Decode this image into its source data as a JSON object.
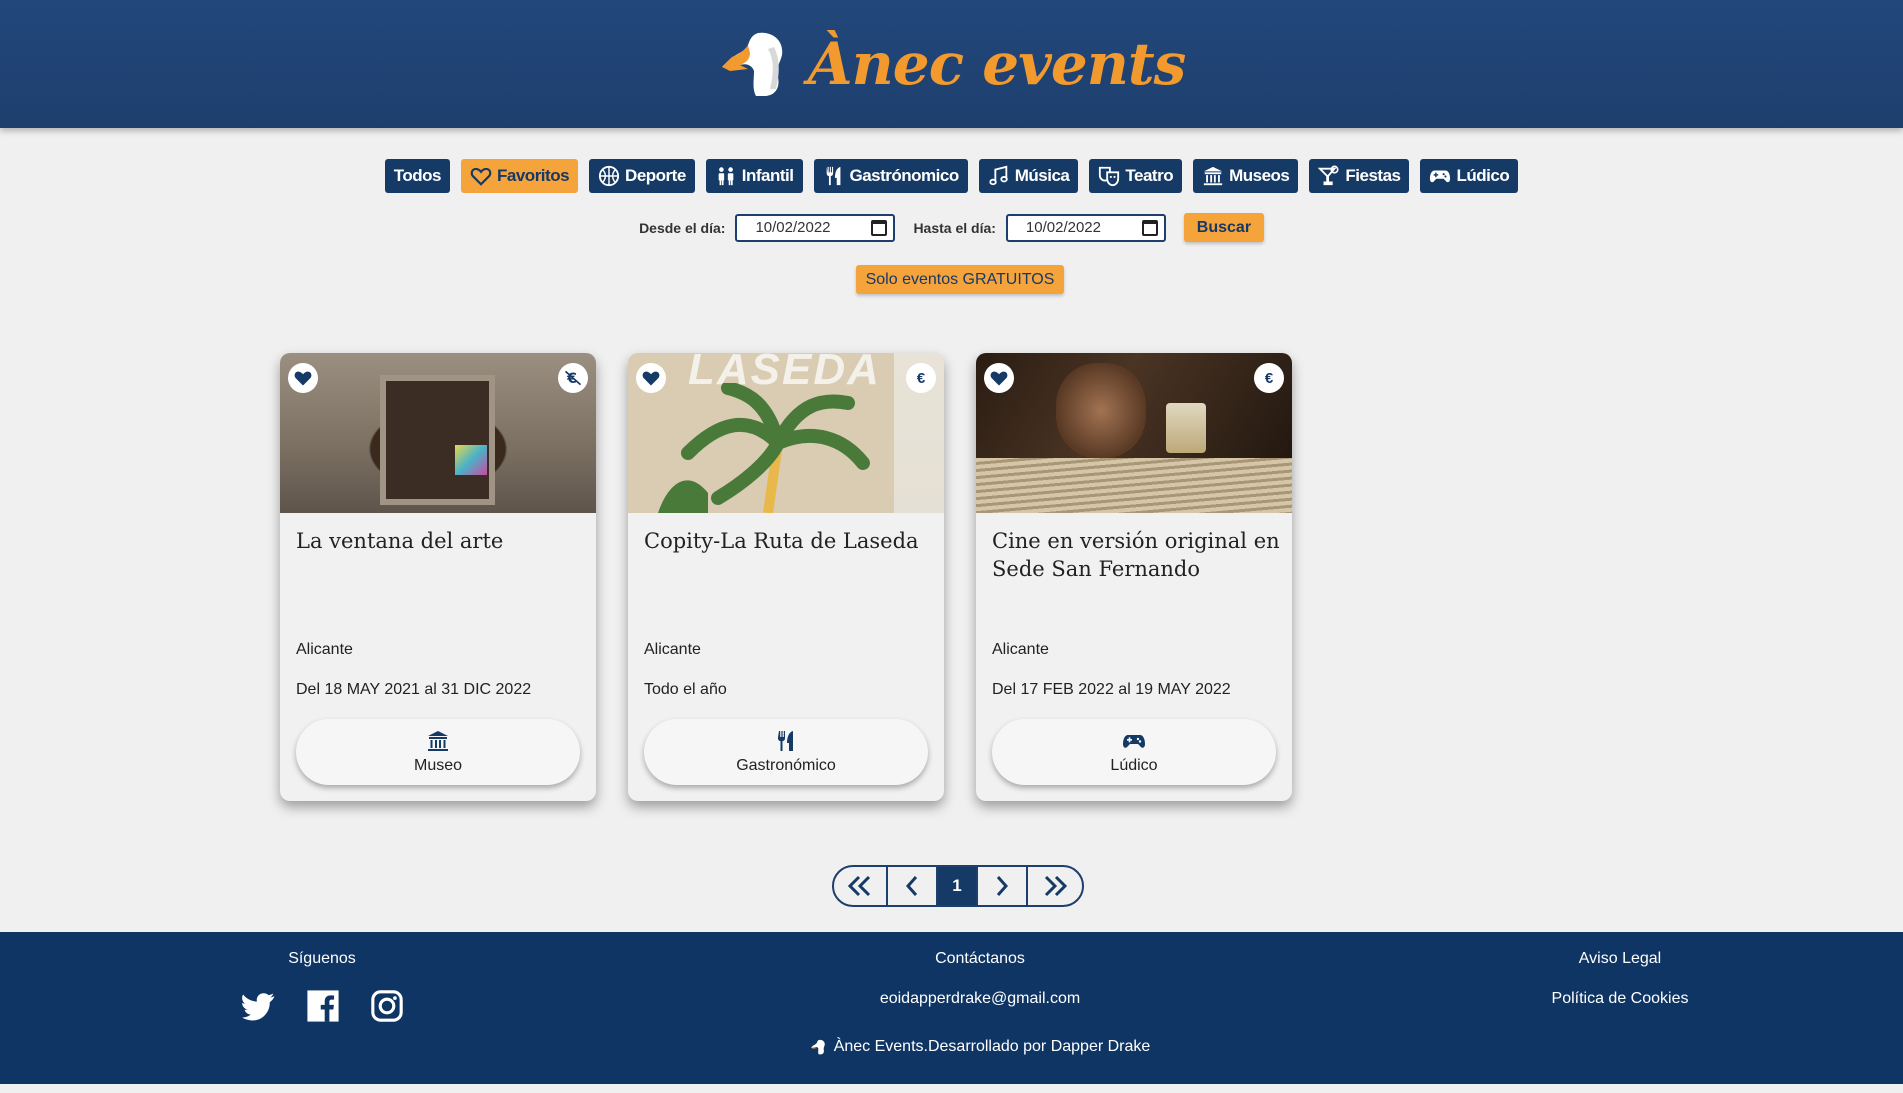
{
  "header": {
    "brand": "Ànec events"
  },
  "categories": [
    {
      "label": "Todos",
      "icon": "none",
      "active": false
    },
    {
      "label": "Favoritos",
      "icon": "heart-icon",
      "active": true
    },
    {
      "label": "Deporte",
      "icon": "basketball-icon",
      "active": false
    },
    {
      "label": "Infantil",
      "icon": "children-icon",
      "active": false
    },
    {
      "label": "Gastrónomico",
      "icon": "utensils-icon",
      "active": false
    },
    {
      "label": "Música",
      "icon": "music-icon",
      "active": false
    },
    {
      "label": "Teatro",
      "icon": "theater-masks-icon",
      "active": false
    },
    {
      "label": "Museos",
      "icon": "museum-icon",
      "active": false
    },
    {
      "label": "Fiestas",
      "icon": "cocktail-icon",
      "active": false
    },
    {
      "label": "Lúdico",
      "icon": "gamepad-icon",
      "active": false
    }
  ],
  "filters": {
    "from_label": "Desde el día:",
    "from_value": "10/02/2022",
    "to_label": "Hasta el día:",
    "to_value": "10/02/2022",
    "search_label": "Buscar",
    "free_label": "Solo eventos GRATUITOS"
  },
  "events": [
    {
      "title": "La ventana del arte",
      "city": "Alicante",
      "dates": "Del 18 MAY 2021 al 31 DIC 2022",
      "category": "Museo",
      "category_icon": "museum-icon",
      "price_icon": "no-euro-icon",
      "price_symbol": "€"
    },
    {
      "title": "Copity-La Ruta de Laseda",
      "city": "Alicante",
      "dates": "Todo el año",
      "category": "Gastronómico",
      "category_icon": "utensils-icon",
      "price_icon": "euro-icon",
      "price_symbol": "€"
    },
    {
      "title": "Cine en versión original en Sede San Fernando",
      "city": "Alicante",
      "dates": "Del 17 FEB 2022 al 19 MAY 2022",
      "category": "Lúdico",
      "category_icon": "gamepad-icon",
      "price_icon": "euro-icon",
      "price_symbol": "€"
    }
  ],
  "card_image_text": {
    "laseda": "LASEDA"
  },
  "pagination": {
    "current": "1"
  },
  "footer": {
    "follow": "Síguenos",
    "contact": "Contáctanos",
    "email": "eoidapperdrake@gmail.com",
    "legal": "Aviso Legal",
    "cookies": "Política de Cookies",
    "credits": "Ànec Events.Desarrollado por Dapper Drake"
  },
  "colors": {
    "primary": "#163a66",
    "accent": "#f4a43a",
    "background": "#f0f0f0"
  }
}
